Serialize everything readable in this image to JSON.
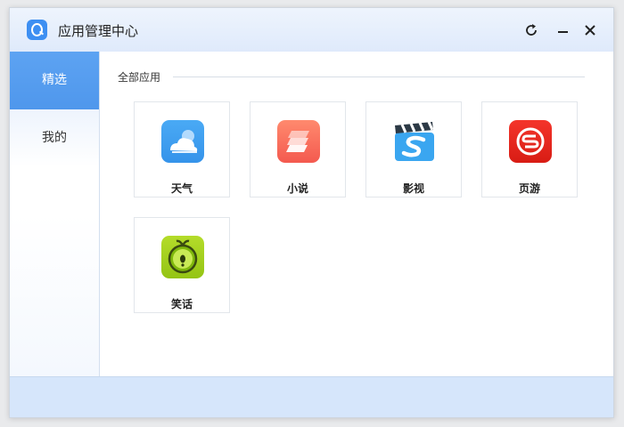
{
  "window": {
    "title": "应用管理中心"
  },
  "sidebar": {
    "items": [
      {
        "label": "精选"
      },
      {
        "label": "我的"
      }
    ]
  },
  "content": {
    "section_title": "全部应用",
    "apps": [
      {
        "label": "天气",
        "icon": "weather-cloud-icon"
      },
      {
        "label": "小说",
        "icon": "novel-books-icon"
      },
      {
        "label": "影视",
        "icon": "video-clapper-icon"
      },
      {
        "label": "页游",
        "icon": "webgame-s-icon"
      },
      {
        "label": "笑话",
        "icon": "joke-melon-icon"
      }
    ]
  },
  "colors": {
    "accent": "#4f97ec",
    "titlebar": "#e6effc",
    "bottombar": "#d6e6fb"
  }
}
